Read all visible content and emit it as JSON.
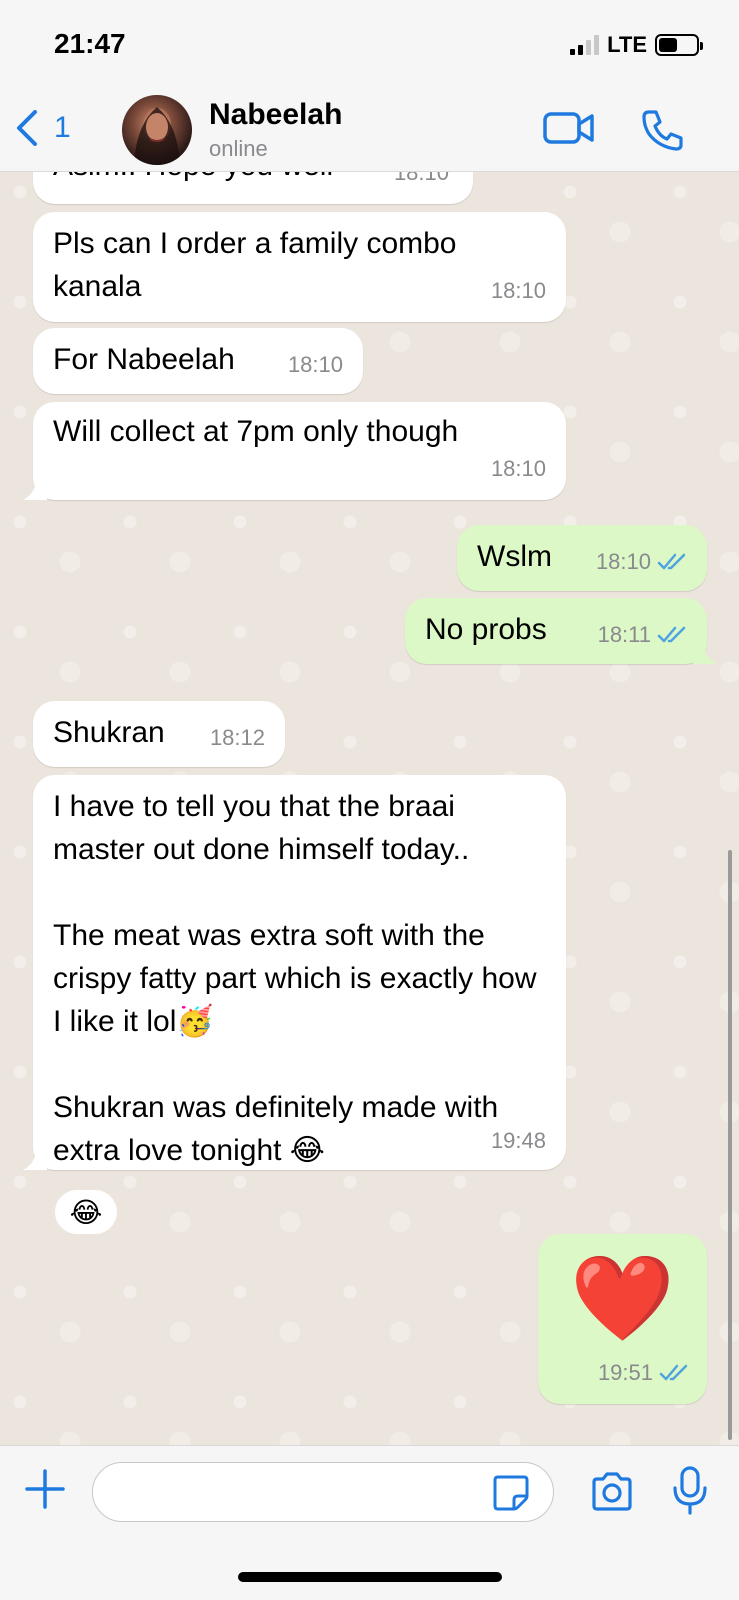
{
  "status_bar": {
    "time": "21:47",
    "network": "LTE",
    "battery_level": 0.5
  },
  "header": {
    "back_count": "1",
    "contact_name": "Nabeelah",
    "contact_status": "online"
  },
  "messages": [
    {
      "direction": "in",
      "text": "Asim.. Hope you well",
      "time": "18:10"
    },
    {
      "direction": "in",
      "text": "Pls can I order a family combo kanala",
      "time": "18:10"
    },
    {
      "direction": "in",
      "text": "For Nabeelah",
      "time": "18:10"
    },
    {
      "direction": "in",
      "text": "Will collect at 7pm only though",
      "time": "18:10"
    },
    {
      "direction": "out",
      "text": "Wslm",
      "time": "18:10",
      "status": "read"
    },
    {
      "direction": "out",
      "text": "No probs",
      "time": "18:11",
      "status": "read"
    },
    {
      "direction": "in",
      "text": "Shukran",
      "time": "18:12"
    },
    {
      "direction": "in",
      "text": "I have to tell you that the braai master out done himself today..\n\nThe meat was extra soft with the crispy fatty part which is exactly how I like it lol🥳\n\nShukran was definitely made with extra love tonight 😂",
      "time": "19:48",
      "reaction": "😂"
    },
    {
      "direction": "out",
      "text": "❤️",
      "time": "19:51",
      "status": "read"
    }
  ],
  "input": {
    "placeholder": ""
  },
  "colors": {
    "accent": "#1f7ae0",
    "outgoing_bubble": "#dcf8c6",
    "incoming_bubble": "#ffffff",
    "chat_background": "#ece5dd",
    "read_ticks": "#4fa3e0"
  },
  "icons": {
    "back": "chevron-left-icon",
    "video": "video-camera-icon",
    "call": "phone-icon",
    "plus": "plus-icon",
    "sticker": "sticker-icon",
    "camera": "camera-icon",
    "mic": "microphone-icon",
    "read": "double-check-icon"
  }
}
